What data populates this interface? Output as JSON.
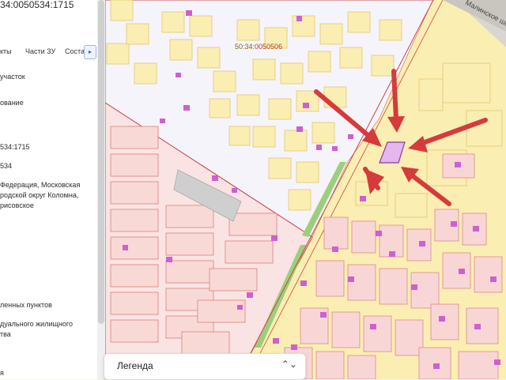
{
  "panel": {
    "title": "34:0050534:1715",
    "tabs": [
      "кты",
      "Части ЗУ",
      "Состав"
    ],
    "tab_arrow": "▸",
    "lines": [
      "участок",
      "ование",
      "534:1715",
      "534",
      "Федерация, Московская",
      "родской округ Коломна,",
      "рисовское",
      "ленных пунктов",
      "дуального жилищного",
      "тва",
      "я"
    ]
  },
  "map": {
    "quarter_label_prefix": "50:34:",
    "quarter_label_number": "0050506",
    "road_label": "Малинское шоссе"
  },
  "legend": {
    "title": "Легенда",
    "chevron": "⌃⌄"
  },
  "colors": {
    "arrow": "#d63a3a",
    "highlight": "#e6b6ee",
    "parcel_yellow": "#fbeeb3",
    "parcel_pink": "#f9d6d6",
    "building": "#cf5fcf"
  }
}
